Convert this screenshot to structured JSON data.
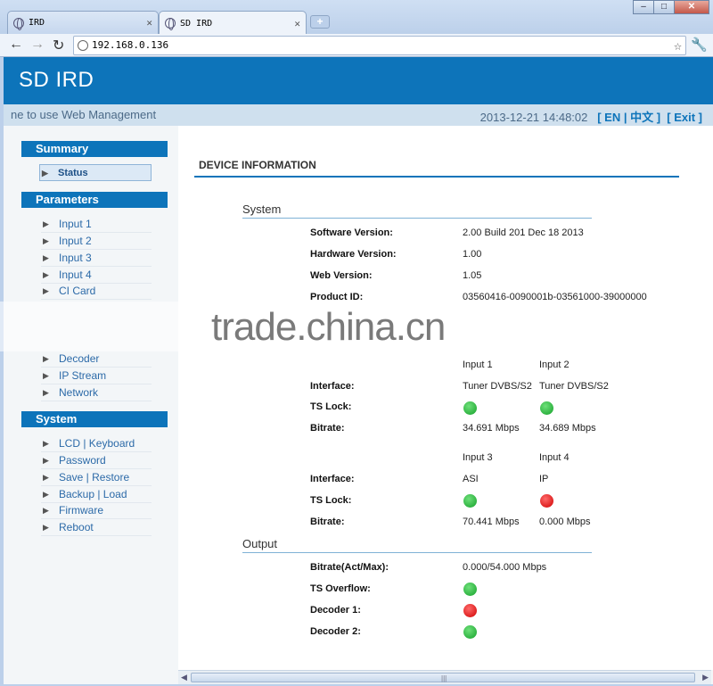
{
  "browser": {
    "tabs": [
      {
        "label": "IRD"
      },
      {
        "label": "SD IRD"
      }
    ],
    "new_tab_label": "+",
    "address": "192.168.0.136",
    "window_buttons": {
      "minimize": "–",
      "maximize": "□",
      "close": "✕"
    }
  },
  "header": {
    "title": "SD IRD",
    "welcome": "ne to use Web Management",
    "datetime": "2013-12-21 14:48:02",
    "lang_links": "[ EN | 中文 ]",
    "exit_link": "[ Exit ]"
  },
  "sidebar": {
    "summary_heading": "Summary",
    "summary_items": [
      {
        "label": "Status"
      }
    ],
    "parameters_heading": "Parameters",
    "parameters_items": [
      {
        "label": "Input 1"
      },
      {
        "label": "Input 2"
      },
      {
        "label": "Input 3"
      },
      {
        "label": "Input 4"
      },
      {
        "label": "CI Card"
      },
      {
        "label": "Decoder"
      },
      {
        "label": "IP Stream"
      },
      {
        "label": "Network"
      }
    ],
    "system_heading": "System",
    "system_items": [
      {
        "label": "LCD | Keyboard"
      },
      {
        "label": "Password"
      },
      {
        "label": "Save | Restore"
      },
      {
        "label": "Backup | Load"
      },
      {
        "label": "Firmware"
      },
      {
        "label": "Reboot"
      }
    ]
  },
  "main": {
    "title": "DEVICE INFORMATION",
    "system_section": "System",
    "software_version_label": "Software Version:",
    "software_version": "2.00 Build 201  Dec 18 2013",
    "hardware_version_label": "Hardware Version:",
    "hardware_version": "1.00",
    "web_version_label": "Web Version:",
    "web_version": "1.05",
    "product_id_label": "Product ID:",
    "product_id": "03560416-0090001b-03561000-39000000",
    "inputs_a": {
      "headers": [
        "Input 1",
        "Input 2"
      ],
      "interface_label": "Interface:",
      "interfaces": [
        "Tuner DVBS/S2",
        "Tuner DVBS/S2"
      ],
      "ts_lock_label": "TS Lock:",
      "ts_lock": [
        "green",
        "green"
      ],
      "bitrate_label": "Bitrate:",
      "bitrates": [
        "34.691 Mbps",
        "34.689 Mbps"
      ]
    },
    "inputs_b": {
      "headers": [
        "Input 3",
        "Input 4"
      ],
      "interface_label": "Interface:",
      "interfaces": [
        "ASI",
        "IP"
      ],
      "ts_lock_label": "TS Lock:",
      "ts_lock": [
        "green",
        "red"
      ],
      "bitrate_label": "Bitrate:",
      "bitrates": [
        "70.441 Mbps",
        "0.000 Mbps"
      ]
    },
    "output_section": "Output",
    "bitrate_actmax_label": "Bitrate(Act/Max):",
    "bitrate_actmax": "0.000/54.000 Mbps",
    "ts_overflow_label": "TS Overflow:",
    "ts_overflow": "green",
    "decoder1_label": "Decoder 1:",
    "decoder1": "red",
    "decoder2_label": "Decoder 2:",
    "decoder2": "green"
  },
  "watermark": "trade.china.cn"
}
